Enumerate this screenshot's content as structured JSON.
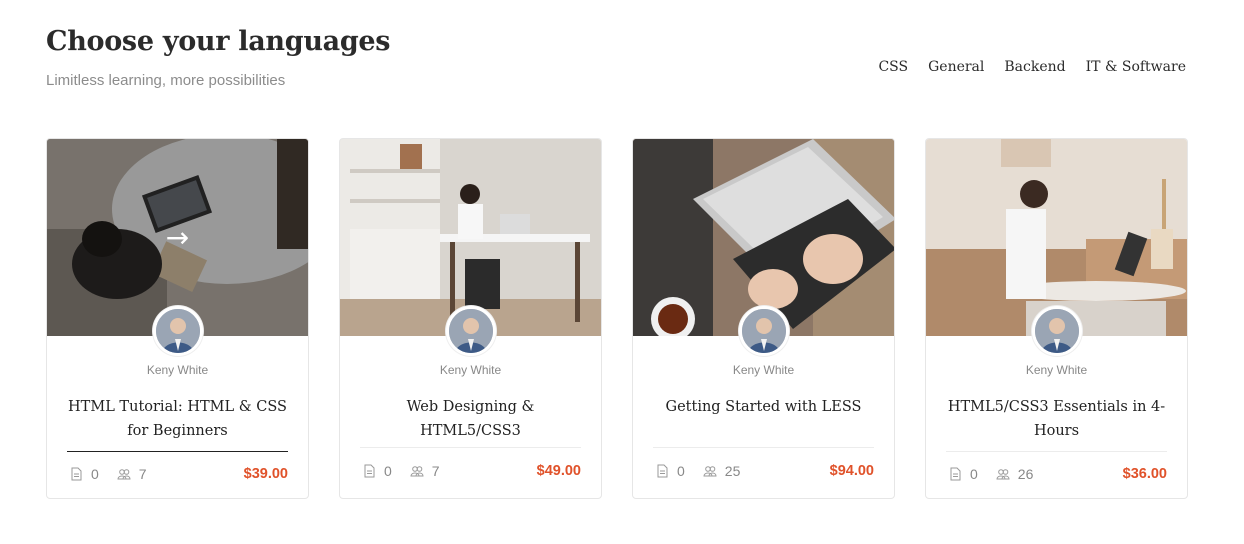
{
  "header": {
    "title": "Choose your languages",
    "subtitle": "Limitless learning, more possibilities"
  },
  "filters": [
    "CSS",
    "General",
    "Backend",
    "IT & Software"
  ],
  "cards": [
    {
      "author": "Keny White",
      "title": "HTML Tutorial: HTML & CSS for Beginners",
      "lessons": "0",
      "students": "7",
      "price": "$39.00",
      "hovered": true
    },
    {
      "author": "Keny White",
      "title": "Web Designing & HTML5/CSS3",
      "lessons": "0",
      "students": "7",
      "price": "$49.00"
    },
    {
      "author": "Keny White",
      "title": "Getting Started with LESS",
      "lessons": "0",
      "students": "25",
      "price": "$94.00"
    },
    {
      "author": "Keny White",
      "title": "HTML5/CSS3 Essentials in 4-Hours",
      "lessons": "0",
      "students": "26",
      "price": "$36.00"
    }
  ],
  "colors": {
    "price": "#e0522a",
    "title": "#2b2b2b",
    "muted": "#8c8c8c"
  },
  "icons": {
    "hover_arrow": "arrow-right-icon",
    "lessons": "document-icon",
    "students": "users-icon"
  }
}
